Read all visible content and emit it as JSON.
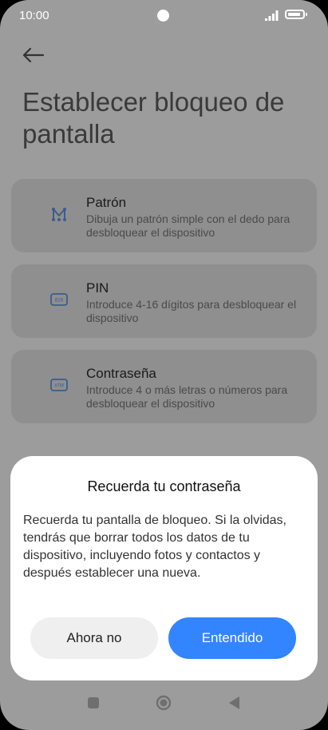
{
  "status_bar": {
    "time": "10:00"
  },
  "page": {
    "title": "Establecer bloqueo de pantalla"
  },
  "options": [
    {
      "title": "Patrón",
      "description": "Dibuja un patrón simple con el dedo para desbloquear el dispositivo",
      "icon": "pattern-icon"
    },
    {
      "title": "PIN",
      "description": "Introduce 4-16 dígitos para desbloquear el dispositivo",
      "icon": "pin-icon",
      "icon_text": "816"
    },
    {
      "title": "Contraseña",
      "description": "Introduce 4 o más letras o números para desbloquear el dispositivo",
      "icon": "password-icon",
      "icon_text": "#7M"
    }
  ],
  "dialog": {
    "title": "Recuerda tu contraseña",
    "message": "Recuerda tu pantalla de bloqueo. Si la olvidas, tendrás que borrar todos los datos de tu dispositivo, incluyendo fotos y contactos y después establecer una nueva.",
    "secondary_label": "Ahora no",
    "primary_label": "Entendido"
  },
  "colors": {
    "accent": "#3385ff",
    "icon": "#3a5d8f"
  }
}
